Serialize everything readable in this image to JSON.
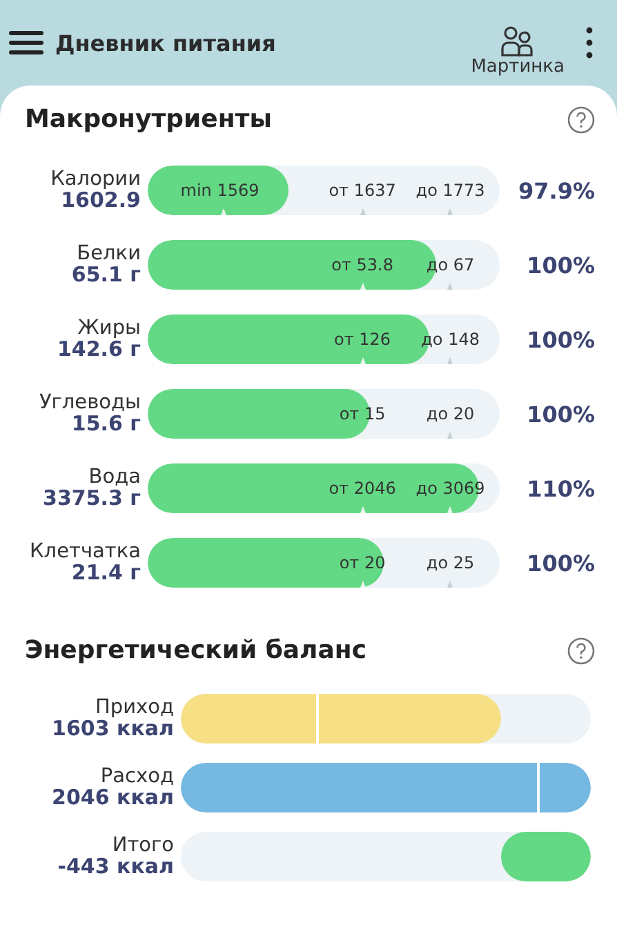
{
  "header": {
    "title": "Дневник питания",
    "profile": "Мартинка"
  },
  "macros": {
    "title": "Макронутриенты",
    "items": [
      {
        "name": "Калории",
        "value": "1602.9",
        "level": 0.4,
        "percent": "97.9%",
        "markers": [
          {
            "kind": "min",
            "text": "min 1569"
          },
          {
            "kind": "from",
            "text": "от 1637"
          },
          {
            "kind": "to",
            "text": "до 1773"
          }
        ]
      },
      {
        "name": "Белки",
        "value": "65.1 г",
        "level": 0.82,
        "percent": "100%",
        "markers": [
          {
            "kind": "from",
            "text": "от 53.8"
          },
          {
            "kind": "to",
            "text": "до 67"
          }
        ]
      },
      {
        "name": "Жиры",
        "value": "142.6 г",
        "level": 0.8,
        "percent": "100%",
        "markers": [
          {
            "kind": "from",
            "text": "от 126"
          },
          {
            "kind": "to",
            "text": "до 148"
          }
        ]
      },
      {
        "name": "Углеводы",
        "value": "15.6 г",
        "level": 0.63,
        "percent": "100%",
        "markers": [
          {
            "kind": "from",
            "text": "от 15"
          },
          {
            "kind": "to",
            "text": "до 20"
          }
        ]
      },
      {
        "name": "Вода",
        "value": "3375.3 г",
        "level": 0.94,
        "percent": "110%",
        "markers": [
          {
            "kind": "from",
            "text": "от 2046"
          },
          {
            "kind": "to",
            "text": "до 3069"
          }
        ]
      },
      {
        "name": "Клетчатка",
        "value": "21.4 г",
        "level": 0.67,
        "percent": "100%",
        "markers": [
          {
            "kind": "from",
            "text": "от 20"
          },
          {
            "kind": "to",
            "text": "до 25"
          }
        ]
      }
    ]
  },
  "balance": {
    "title": "Энергетический баланс",
    "items": [
      {
        "kind": "intake",
        "name": "Приход",
        "value": "1603 ккал",
        "level": 0.78
      },
      {
        "kind": "expense",
        "name": "Расход",
        "value": "2046 ккал",
        "level": 1
      },
      {
        "kind": "total",
        "name": "Итого",
        "value": "-443 ккал",
        "level": 0.22
      }
    ]
  }
}
